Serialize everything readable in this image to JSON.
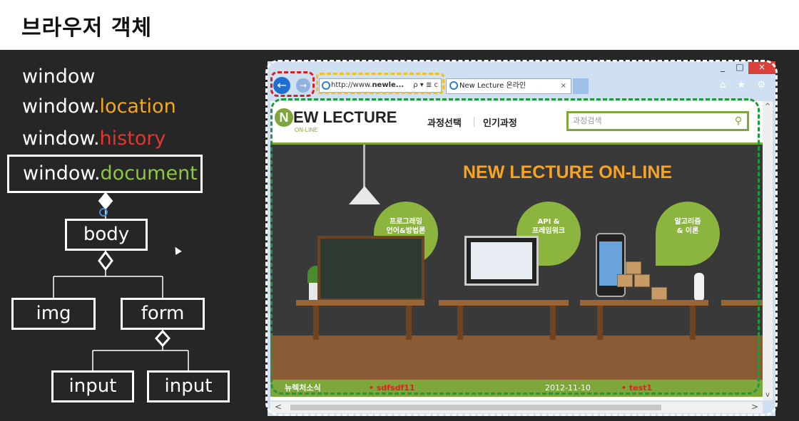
{
  "slide_title": "브라우저 객체",
  "objects": {
    "window": "window",
    "location_prefix": "window.",
    "location_prop": "location",
    "history_prefix": "window.",
    "history_prop": "history",
    "document_prefix": "window.",
    "document_prop": "document"
  },
  "colors": {
    "location": "#f5a623",
    "history": "#e8342c",
    "document": "#8dc63f",
    "brand_green": "#7da73a",
    "banner_orange": "#f7a425"
  },
  "tree": {
    "body": "body",
    "img": "img",
    "form": "form",
    "input1": "input",
    "input2": "input"
  },
  "browser": {
    "window_controls": [
      "_",
      "□",
      "×"
    ],
    "back_icon": "←",
    "forward_icon": "→",
    "address_prefix": "http://www.",
    "address_bold": "newle...",
    "address_tools": "ρ ▾ ≣ c",
    "tab_title": "New Lecture 온라인",
    "tab_close": "×",
    "toolbar_icons": "⌂ ★ ⚙"
  },
  "site": {
    "logo_letter": "N",
    "logo_text": "EW LECTURE",
    "logo_sub": "ON-LINE",
    "menu": [
      "과정선택",
      "인기과정"
    ],
    "search_placeholder": "과정검색",
    "search_icon": "⚲",
    "banner_title": "NEW LECTURE ON-LINE",
    "bubbles": [
      {
        "line1": "프로그래밍",
        "line2": "언어&방법론"
      },
      {
        "line1": "API &",
        "line2": "프레임워크"
      },
      {
        "line1": "알고리즘",
        "line2": "& 이론"
      }
    ],
    "news": {
      "title": "뉴렉처소식",
      "item1": "• sdfsdf11",
      "date": "2012-11-10",
      "item2": "• test1"
    }
  },
  "scrollbar": {
    "up": "^",
    "down": "v",
    "left": "<",
    "right": ">"
  }
}
